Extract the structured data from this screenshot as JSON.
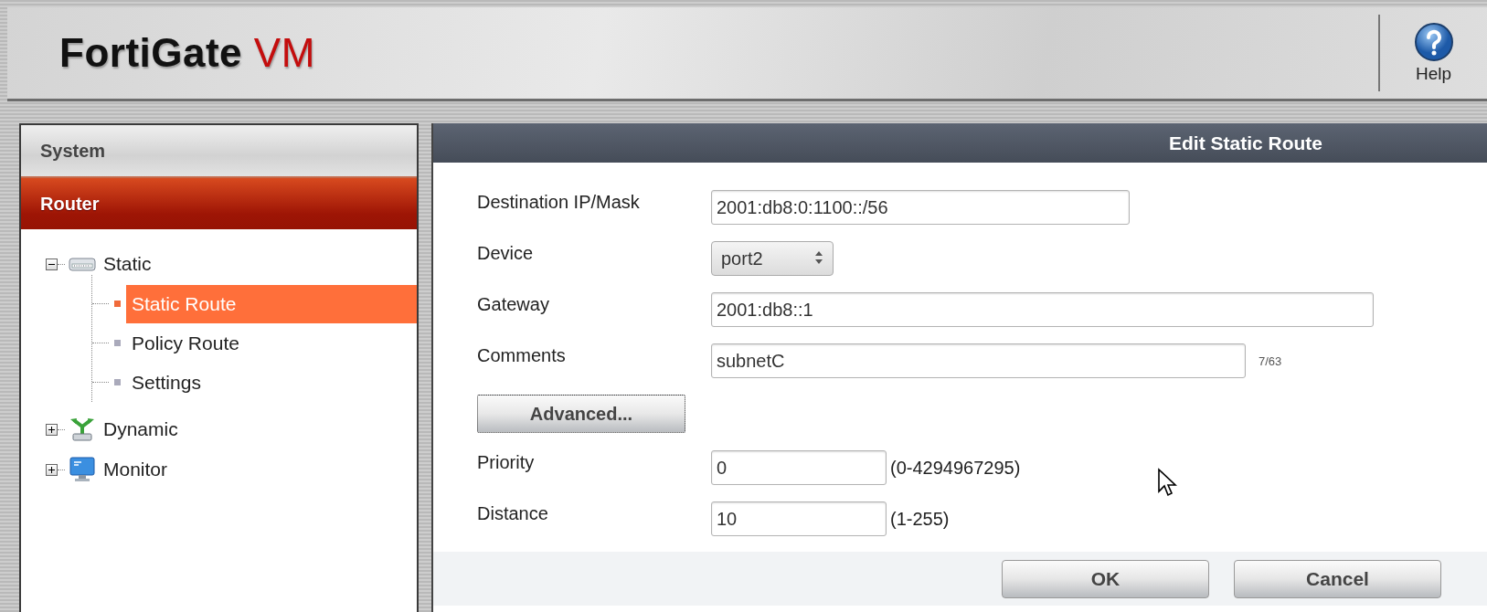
{
  "header": {
    "brand": "FortiGate",
    "suffix": "VM",
    "help": "Help"
  },
  "sidebar": {
    "sections": [
      {
        "label": "System",
        "selected": false
      },
      {
        "label": "Router",
        "selected": true
      }
    ],
    "tree": [
      {
        "label": "Static",
        "kind": "switch",
        "expanded": true,
        "children": [
          {
            "label": "Static Route",
            "selected": true
          },
          {
            "label": "Policy Route",
            "selected": false
          },
          {
            "label": "Settings",
            "selected": false
          }
        ]
      },
      {
        "label": "Dynamic",
        "kind": "branch",
        "expanded": false
      },
      {
        "label": "Monitor",
        "kind": "monitor",
        "expanded": false
      }
    ]
  },
  "dialog": {
    "title": "Edit Static Route",
    "rows": [
      {
        "kind": "text",
        "label": "Destination IP/Mask",
        "value": "2001:db8:0:1100::/56"
      },
      {
        "kind": "select",
        "label": "Device",
        "value": "port2"
      },
      {
        "kind": "text",
        "label": "Gateway",
        "value": "2001:db8::1"
      },
      {
        "kind": "text",
        "label": "Comments",
        "value": "subnetC",
        "counter": "7/63"
      },
      {
        "kind": "button",
        "label": "Advanced..."
      },
      {
        "kind": "text",
        "label": "Priority",
        "value": "0",
        "hint": "(0-4294967295)"
      },
      {
        "kind": "text",
        "label": "Distance",
        "value": "10",
        "hint": "(1-255)"
      }
    ],
    "buttons": [
      "OK",
      "Cancel"
    ]
  }
}
